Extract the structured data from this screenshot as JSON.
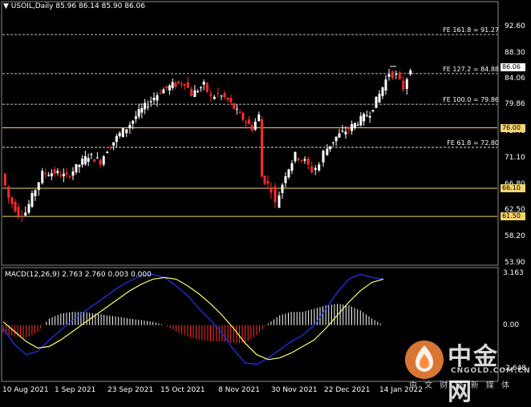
{
  "chart_title": "USOIL,Daily  85.96 86.14 85.90 86.06",
  "price_axis": [
    "92.60",
    "88.30",
    "84.06",
    "79.86",
    "75.40",
    "71.10",
    "66.80",
    "62.50",
    "58.20",
    "53.90"
  ],
  "fib_levels": [
    {
      "label": "FE 161.8 = 91.27",
      "price": 91.27
    },
    {
      "label": "FE 127.2 = 84.88",
      "price": 84.88
    },
    {
      "label": "FE 100.0 = 79.86",
      "price": 79.86
    },
    {
      "label": "FE 61.8 = 72.80",
      "price": 72.8
    }
  ],
  "horizontal_levels": [
    "76.00",
    "66.10",
    "61.50"
  ],
  "current_price": "86.06",
  "macd_title": "MACD(12,26,9) 2.763 2.760 0.003 0.000",
  "macd_axis": [
    "3.163",
    "0.00",
    "-2.648"
  ],
  "date_axis": [
    "10 Aug 2021",
    "1 Sep 2021",
    "23 Sep 2021",
    "15 Oct 2021",
    "8 Nov 2021",
    "30 Nov 2021",
    "22 Dec 2021",
    "14 Jan 2022"
  ],
  "watermark": {
    "name": "中金网",
    "domain": "CNGOLD.COM.CN",
    "slogan": "中 文 财 经 新 媒 体"
  },
  "colors": {
    "bull": "#ffffff",
    "bear": "#ff2a2a",
    "fib_line": "#ffffff",
    "level_line": "#f2d46e",
    "signal": "#ffff66",
    "macd_line": "#2233ff"
  },
  "chart_data": {
    "type": "candlestick",
    "symbol": "USOIL",
    "timeframe": "Daily",
    "last_bar": {
      "open": 85.96,
      "high": 86.14,
      "low": 85.9,
      "close": 86.06
    },
    "ylim": [
      53.9,
      94.6
    ],
    "x_ticks": [
      "10 Aug 2021",
      "1 Sep 2021",
      "23 Sep 2021",
      "15 Oct 2021",
      "8 Nov 2021",
      "30 Nov 2021",
      "22 Dec 2021",
      "14 Jan 2022"
    ],
    "close_path": [
      [
        "10 Aug 2021",
        68.5
      ],
      [
        "13 Aug 2021",
        64.5
      ],
      [
        "17 Aug 2021",
        62.0
      ],
      [
        "20 Aug 2021",
        62.2
      ],
      [
        "24 Aug 2021",
        66.0
      ],
      [
        "27 Aug 2021",
        68.5
      ],
      [
        "1 Sep 2021",
        68.7
      ],
      [
        "6 Sep 2021",
        68.0
      ],
      [
        "10 Sep 2021",
        69.5
      ],
      [
        "15 Sep 2021",
        71.5
      ],
      [
        "20 Sep 2021",
        70.5
      ],
      [
        "23 Sep 2021",
        72.5
      ],
      [
        "28 Sep 2021",
        75.0
      ],
      [
        "1 Oct 2021",
        76.0
      ],
      [
        "6 Oct 2021",
        78.5
      ],
      [
        "11 Oct 2021",
        80.5
      ],
      [
        "15 Oct 2021",
        82.0
      ],
      [
        "20 Oct 2021",
        83.0
      ],
      [
        "25 Oct 2021",
        83.5
      ],
      [
        "28 Oct 2021",
        81.5
      ],
      [
        "2 Nov 2021",
        83.0
      ],
      [
        "5 Nov 2021",
        81.0
      ],
      [
        "8 Nov 2021",
        81.5
      ],
      [
        "12 Nov 2021",
        80.5
      ],
      [
        "17 Nov 2021",
        78.0
      ],
      [
        "22 Nov 2021",
        76.0
      ],
      [
        "25 Nov 2021",
        78.0
      ],
      [
        "26 Nov 2021",
        68.0
      ],
      [
        "30 Nov 2021",
        66.0
      ],
      [
        "2 Dec 2021",
        63.5
      ],
      [
        "6 Dec 2021",
        68.5
      ],
      [
        "10 Dec 2021",
        71.5
      ],
      [
        "14 Dec 2021",
        70.5
      ],
      [
        "17 Dec 2021",
        69.0
      ],
      [
        "20 Dec 2021",
        70.0
      ],
      [
        "22 Dec 2021",
        72.0
      ],
      [
        "27 Dec 2021",
        74.5
      ],
      [
        "31 Dec 2021",
        75.5
      ],
      [
        "5 Jan 2022",
        77.0
      ],
      [
        "10 Jan 2022",
        78.5
      ],
      [
        "14 Jan 2022",
        81.5
      ],
      [
        "18 Jan 2022",
        85.0
      ],
      [
        "21 Jan 2022",
        84.5
      ],
      [
        "24 Jan 2022",
        82.5
      ],
      [
        "27 Jan 2022",
        86.0
      ]
    ],
    "fibonacci_extensions": [
      {
        "name": "FE 161.8",
        "value": 91.27
      },
      {
        "name": "FE 127.2",
        "value": 84.88
      },
      {
        "name": "FE 100.0",
        "value": 79.86
      },
      {
        "name": "FE 61.8",
        "value": 72.8
      }
    ],
    "horizontal_levels": [
      76.0,
      66.1,
      61.5
    ],
    "macd": {
      "params": "12,26,9",
      "values": [
        2.763,
        2.76,
        0.003,
        0.0
      ],
      "ylim": [
        -2.648,
        3.163
      ],
      "macd_line": [
        -0.2,
        -1.2,
        -1.8,
        -1.6,
        -0.9,
        -0.3,
        0.3,
        0.8,
        1.3,
        1.8,
        2.3,
        2.7,
        3.0,
        3.1,
        2.9,
        2.4,
        1.8,
        1.0,
        0.3,
        -0.5,
        -1.5,
        -2.3,
        -2.4,
        -2.0,
        -1.5,
        -1.0,
        -0.6,
        0.0,
        1.0,
        2.0,
        2.8,
        3.1,
        2.9,
        2.8
      ],
      "signal_line": [
        0.2,
        -0.4,
        -1.0,
        -1.4,
        -1.3,
        -0.9,
        -0.4,
        0.1,
        0.6,
        1.1,
        1.6,
        2.1,
        2.5,
        2.8,
        2.9,
        2.8,
        2.4,
        1.9,
        1.3,
        0.6,
        -0.2,
        -1.1,
        -1.8,
        -2.1,
        -2.0,
        -1.7,
        -1.3,
        -0.9,
        -0.2,
        0.6,
        1.4,
        2.1,
        2.6,
        2.8
      ],
      "histogram": [
        -0.5,
        -0.7,
        -0.8,
        -0.4,
        0.4,
        0.7,
        0.8,
        0.8,
        0.7,
        0.6,
        0.5,
        0.4,
        0.3,
        0.2,
        0.0,
        -0.4,
        -0.7,
        -0.9,
        -1.0,
        -1.0,
        -1.1,
        -1.1,
        -0.6,
        0.1,
        0.6,
        0.8,
        0.8,
        1.0,
        1.2,
        1.3,
        1.2,
        0.9,
        0.4,
        0.0
      ]
    }
  }
}
